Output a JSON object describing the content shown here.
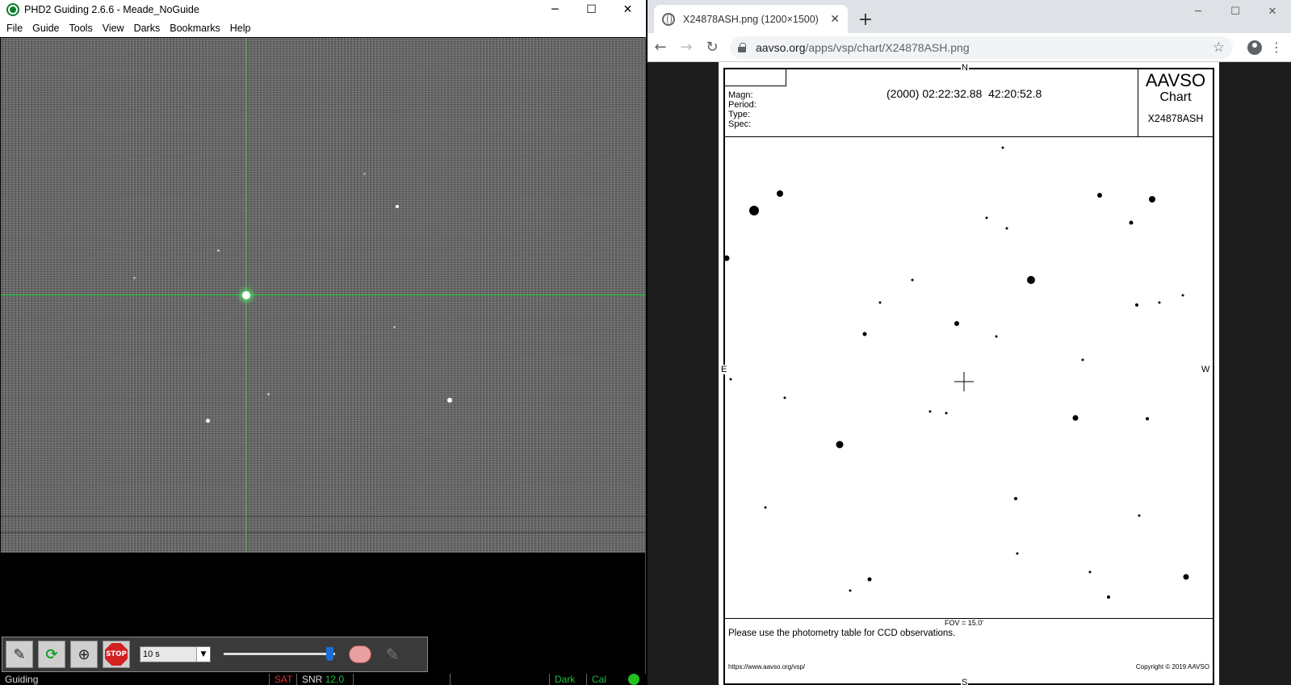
{
  "phd2": {
    "title": "PHD2 Guiding 2.6.6 - Meade_NoGuide",
    "window_controls": {
      "minimize": "─",
      "maximize": "☐",
      "close": "✕"
    },
    "menu": [
      "File",
      "Guide",
      "Tools",
      "View",
      "Darks",
      "Bookmarks",
      "Help"
    ],
    "toolbar": {
      "exposure_value": "10 s",
      "stop_label": "STOP",
      "gamma_level": 0.9
    },
    "status": {
      "state": "Guiding",
      "sat": "SAT",
      "snr_label": "SNR",
      "snr_value": "12.0",
      "dark": "Dark",
      "cal": "Cal"
    },
    "colors": {
      "crosshair": "#1fdc3c",
      "status_green": "#1fbf3c",
      "status_red": "#e03030"
    }
  },
  "chrome": {
    "tab_title": "X24878ASH.png (1200×1500)",
    "tab_close": "✕",
    "new_tab": "+",
    "window_controls": {
      "minimize": "─",
      "maximize": "☐",
      "close": "✕"
    },
    "nav": {
      "back": "←",
      "forward": "→",
      "reload": "↻"
    },
    "url_host": "aavso.org",
    "url_path": "/apps/vsp/chart/X24878ASH.png",
    "bookmark_icon": "☆",
    "menu_icon": "⋮"
  },
  "chart": {
    "fields": [
      "Magn:",
      "Period:",
      "Type:",
      "Spec:"
    ],
    "coords": "(2000) 02:22:32.88  42:20:52.8",
    "logo_line1": "AAVSO",
    "logo_line2": "Chart",
    "chart_id": "X24878ASH",
    "dir_n": "N",
    "dir_e": "E",
    "dir_w": "W",
    "dir_s": "S",
    "fov": "FOV = 15.0'",
    "photometry_note": "Please use the photometry table for CCD observations.",
    "footer_url": "https://www.aavso.org/vsp/",
    "copyright": "Copyright © 2019 AAVSO"
  }
}
